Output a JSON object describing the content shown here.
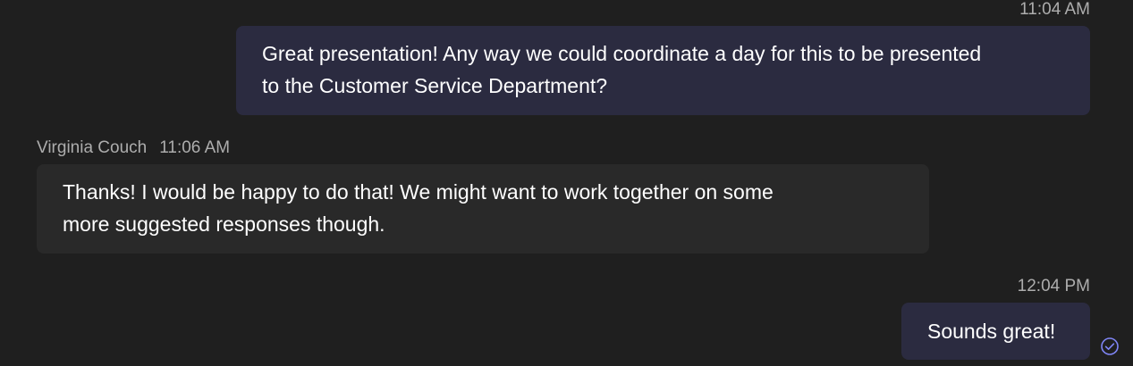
{
  "messages": [
    {
      "side": "outgoing",
      "time": "11:04 AM",
      "text_line1": "Great presentation! Any way we could coordinate a day for this to be presented",
      "text_line2": "to the Customer Service Department?"
    },
    {
      "side": "incoming",
      "sender": "Virginia Couch",
      "time": "11:06 AM",
      "text_line1": "Thanks! I would be happy to do that! We might want to work together on some",
      "text_line2": "more suggested responses though."
    },
    {
      "side": "outgoing",
      "time": "12:04 PM",
      "text": "Sounds great!"
    }
  ],
  "status": {
    "read_icon": "check-circle-icon",
    "accent_color": "#7f85f5"
  }
}
